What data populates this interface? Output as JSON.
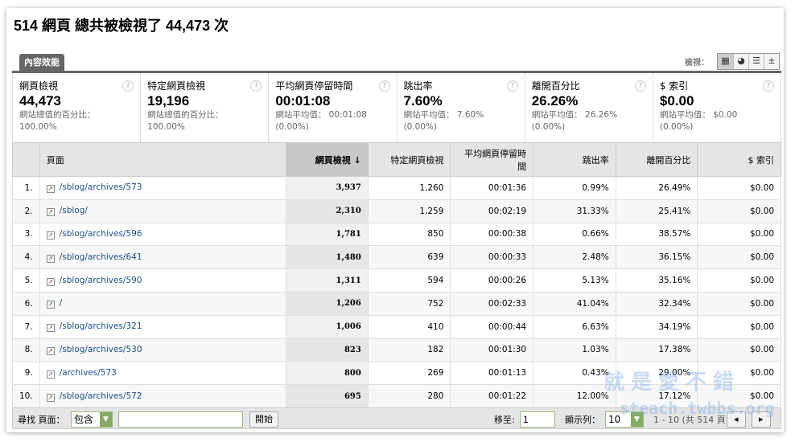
{
  "title": "514 網頁 總共被檢視了 44,473 次",
  "tab": "內容效能",
  "view_label": "檢視：",
  "view_icons": [
    "table-view-icon",
    "pie-view-icon",
    "bar-view-icon",
    "compare-view-icon"
  ],
  "summary": [
    {
      "label": "網頁檢視",
      "value": "44,473",
      "sub1": "網站總值的百分比：",
      "sub2": "100.00%"
    },
    {
      "label": "特定網頁檢視",
      "value": "19,196",
      "sub1": "網站總值的百分比：",
      "sub2": "100.00%"
    },
    {
      "label": "平均網頁停留時間",
      "value": "00:01:08",
      "sub1": "網站平均值： 00:01:08",
      "sub2": "(0.00%)"
    },
    {
      "label": "跳出率",
      "value": "7.60%",
      "sub1": "網站平均值： 7.60%",
      "sub2": "(0.00%)"
    },
    {
      "label": "離開百分比",
      "value": "26.26%",
      "sub1": "網站平均值： 26.26%",
      "sub2": "(0.00%)"
    },
    {
      "label": "$ 索引",
      "value": "$0.00",
      "sub1": "網站平均值： $0.00",
      "sub2": "(0.00%)"
    }
  ],
  "columns": [
    "",
    "頁面",
    "網頁檢視 ↓",
    "特定網頁檢視",
    "平均網頁停留時間",
    "跳出率",
    "離開百分比",
    "$ 索引"
  ],
  "rows": [
    [
      "1.",
      "/sblog/archives/573",
      "3,937",
      "1,260",
      "00:01:36",
      "0.99%",
      "26.49%",
      "$0.00"
    ],
    [
      "2.",
      "/sblog/",
      "2,310",
      "1,259",
      "00:02:19",
      "31.33%",
      "25.41%",
      "$0.00"
    ],
    [
      "3.",
      "/sblog/archives/596",
      "1,781",
      "850",
      "00:00:38",
      "0.66%",
      "38.57%",
      "$0.00"
    ],
    [
      "4.",
      "/sblog/archives/641",
      "1,480",
      "639",
      "00:00:33",
      "2.48%",
      "36.15%",
      "$0.00"
    ],
    [
      "5.",
      "/sblog/archives/590",
      "1,311",
      "594",
      "00:00:26",
      "5.13%",
      "35.16%",
      "$0.00"
    ],
    [
      "6.",
      "/",
      "1,206",
      "752",
      "00:02:33",
      "41.04%",
      "32.34%",
      "$0.00"
    ],
    [
      "7.",
      "/sblog/archives/321",
      "1,006",
      "410",
      "00:00:44",
      "6.63%",
      "34.19%",
      "$0.00"
    ],
    [
      "8.",
      "/sblog/archives/530",
      "823",
      "182",
      "00:01:30",
      "1.03%",
      "17.38%",
      "$0.00"
    ],
    [
      "9.",
      "/archives/573",
      "800",
      "269",
      "00:01:13",
      "0.43%",
      "29.00%",
      "$0.00"
    ],
    [
      "10.",
      "/sblog/archives/572",
      "695",
      "280",
      "00:01:22",
      "12.00%",
      "17.12%",
      "$0.00"
    ]
  ],
  "footer": {
    "find_label": "尋找 頁面：",
    "match": "包含",
    "search_value": "",
    "go": "開始",
    "goto_label": "移至:",
    "goto_value": "1",
    "show_label": "顯示列：",
    "show_value": "10",
    "range": "1 - 10 (共 514 頁)"
  },
  "watermark": {
    "line1": "就是愛不錯",
    "line2": "steach.twbbs.org"
  }
}
